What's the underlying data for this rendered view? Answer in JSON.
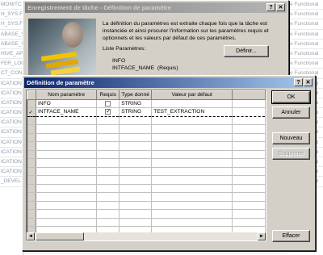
{
  "background": {
    "left_rows": [
      "MONITC",
      "H_SYS.F",
      "H_SYS.F",
      "ABASE_S",
      "ABASE_S",
      "HIVE_AP",
      "FER_LOG",
      "CT_CON",
      "ICATION",
      "ICATION",
      "ICATION",
      "ICATION",
      "ICATION",
      "ICATION",
      "ICATION",
      "ICATION",
      "ICATION",
      "ICATION",
      "_DEVEL"
    ],
    "right_rows": [
      "e Functional",
      "e Functional",
      "e Functional",
      "e Functional",
      "e Functional",
      "e Functional",
      "e Functional",
      "e Functional",
      "e Functional",
      "e Functional",
      "e Functional",
      "e Functional",
      "e Functional",
      "e Functional",
      "e Functional",
      "e Functional",
      "e Functional",
      "e Functional",
      "e Functional"
    ]
  },
  "parent_window": {
    "title": "Enregistrement de tâche - Définition de paramètre",
    "help_btn": "?",
    "close_btn": "✕",
    "description": "La définition du paramètres est extraite chaque fois que la tâche est instanciée et ainsi procurer l'information sur les paramètres requis et optionnels et les valeurs par défaut de ces paramètres.",
    "list_label": "Liste Paramètres:",
    "list_items": [
      "INFO",
      "INTFACE_NAME  (Requis)"
    ],
    "define_button": "Définir..."
  },
  "dialog": {
    "title": "Définition de paramètre",
    "help_btn": "?",
    "close_btn": "✕",
    "columns": [
      "Nom paramètre",
      "Requis",
      "Type donné",
      "Valeur par défaut"
    ],
    "rows": [
      {
        "selector": "",
        "name": "INFO",
        "required": "",
        "type": "STRING",
        "default": ""
      },
      {
        "selector": "✓",
        "name": "INTFACE_NAME",
        "required": "✓",
        "type": "STRING",
        "default": "TEST_EXTRACTION"
      }
    ],
    "buttons": {
      "ok": "OK",
      "cancel": "Annuler",
      "new": "Nouveau",
      "delete": "Supprimer",
      "clear": "Effacer"
    },
    "scroll_left": "◄",
    "scroll_right": "►"
  }
}
